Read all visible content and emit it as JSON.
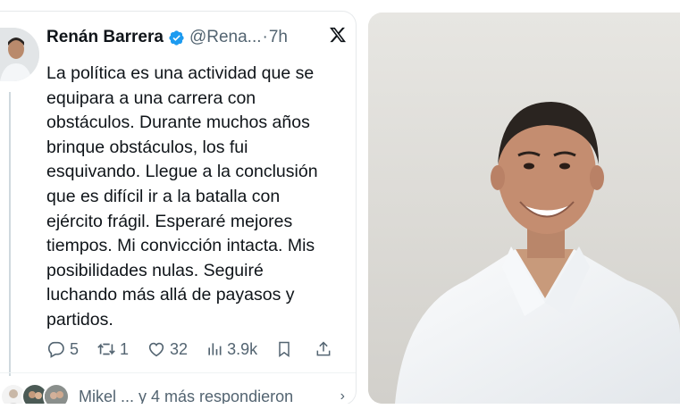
{
  "tweet": {
    "author_name": "Renán Barrera",
    "handle": "@Rena...",
    "separator": "·",
    "time": "7h",
    "text": "La política es una actividad que se equipara a una carrera con obstáculos. Durante muchos años brinque obstáculos, los fui esquivando. Llegue a la conclusión que es difícil ir a la batalla con ejército frágil. Esperaré mejores tiempos. Mi convicción intacta. Mis posibilidades nulas. Seguiré luchando más allá de payasos y partidos.",
    "actions": {
      "replies": "5",
      "reposts": "1",
      "likes": "32",
      "views": "3.9k"
    },
    "replied_by": "Mikel ... y 4 más respondieron",
    "chevron": "›"
  },
  "colors": {
    "verified": "#1d9bf0",
    "text": "#0f1419",
    "secondary": "#536471"
  }
}
